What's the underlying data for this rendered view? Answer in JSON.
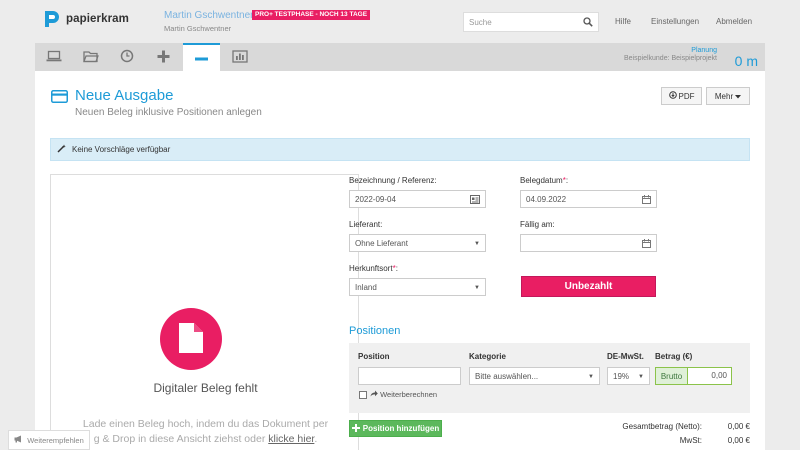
{
  "app": {
    "name": "papierkram",
    "brand_color": "#1e9bd7",
    "accent_color": "#e91e63"
  },
  "header": {
    "user_name": "Martin Gschwentner",
    "user_sub": "Martin Gschwentner",
    "trial_badge": "PRO+ TESTPHASE - NOCH 13 TAGE",
    "search_placeholder": "Suche",
    "links": {
      "help": "Hilfe",
      "settings": "Einstellungen",
      "logout": "Abmelden"
    }
  },
  "nav": {
    "tabs": [
      {
        "icon": "laptop-icon",
        "active": false
      },
      {
        "icon": "folder-icon",
        "active": false
      },
      {
        "icon": "clock-icon",
        "active": false
      },
      {
        "icon": "plus-icon",
        "active": false
      },
      {
        "icon": "minus-icon",
        "active": true
      },
      {
        "icon": "chart-icon",
        "active": false
      }
    ],
    "planning_label": "Planung",
    "planning_project": "Beispielkunde: Beispielprojekt",
    "planning_value": "0 m"
  },
  "page": {
    "title": "Neue Ausgabe",
    "subtitle": "Neuen Beleg inklusive Positionen anlegen",
    "pdf_label": "PDF",
    "more_label": "Mehr"
  },
  "alert": {
    "text": "Keine Vorschläge verfügbar"
  },
  "dropzone": {
    "title": "Digitaler Beleg fehlt",
    "hint_line1": "Lade einen Beleg hoch, indem du das Dokument per",
    "hint_line2": "g & Drop in diese Ansicht ziehst oder",
    "hint_link": "klicke hier",
    "hint_end": "."
  },
  "form": {
    "reference_label": "Bezeichnung / Referenz:",
    "reference_value": "2022-09-04",
    "date_label": "Belegdatum",
    "date_value": "04.09.2022",
    "supplier_label": "Lieferant:",
    "supplier_value": "Ohne Lieferant",
    "due_label": "Fällig am:",
    "due_value": "",
    "origin_label": "Herkunftsort",
    "origin_value": "Inland",
    "unpaid_button": "Unbezahlt",
    "required_mark": "*",
    "colon": ":"
  },
  "positions": {
    "section_title": "Positionen",
    "col_position": "Position",
    "col_category": "Kategorie",
    "col_vat": "DE-MwSt.",
    "col_amount": "Betrag (€)",
    "position_value": "",
    "category_value": "Bitte auswählen...",
    "vat_value": "19%",
    "amount_mode": "Brutto",
    "amount_value": "0,00",
    "recalc_label": "Weiterberechnen",
    "add_button": "Position hinzufügen"
  },
  "totals": {
    "net_label": "Gesamtbetrag (Netto):",
    "net_value": "0,00 €",
    "vat_label": "MwSt:",
    "vat_value": "0,00 €"
  },
  "footer": {
    "recommend_label": "Weiterempfehlen"
  }
}
